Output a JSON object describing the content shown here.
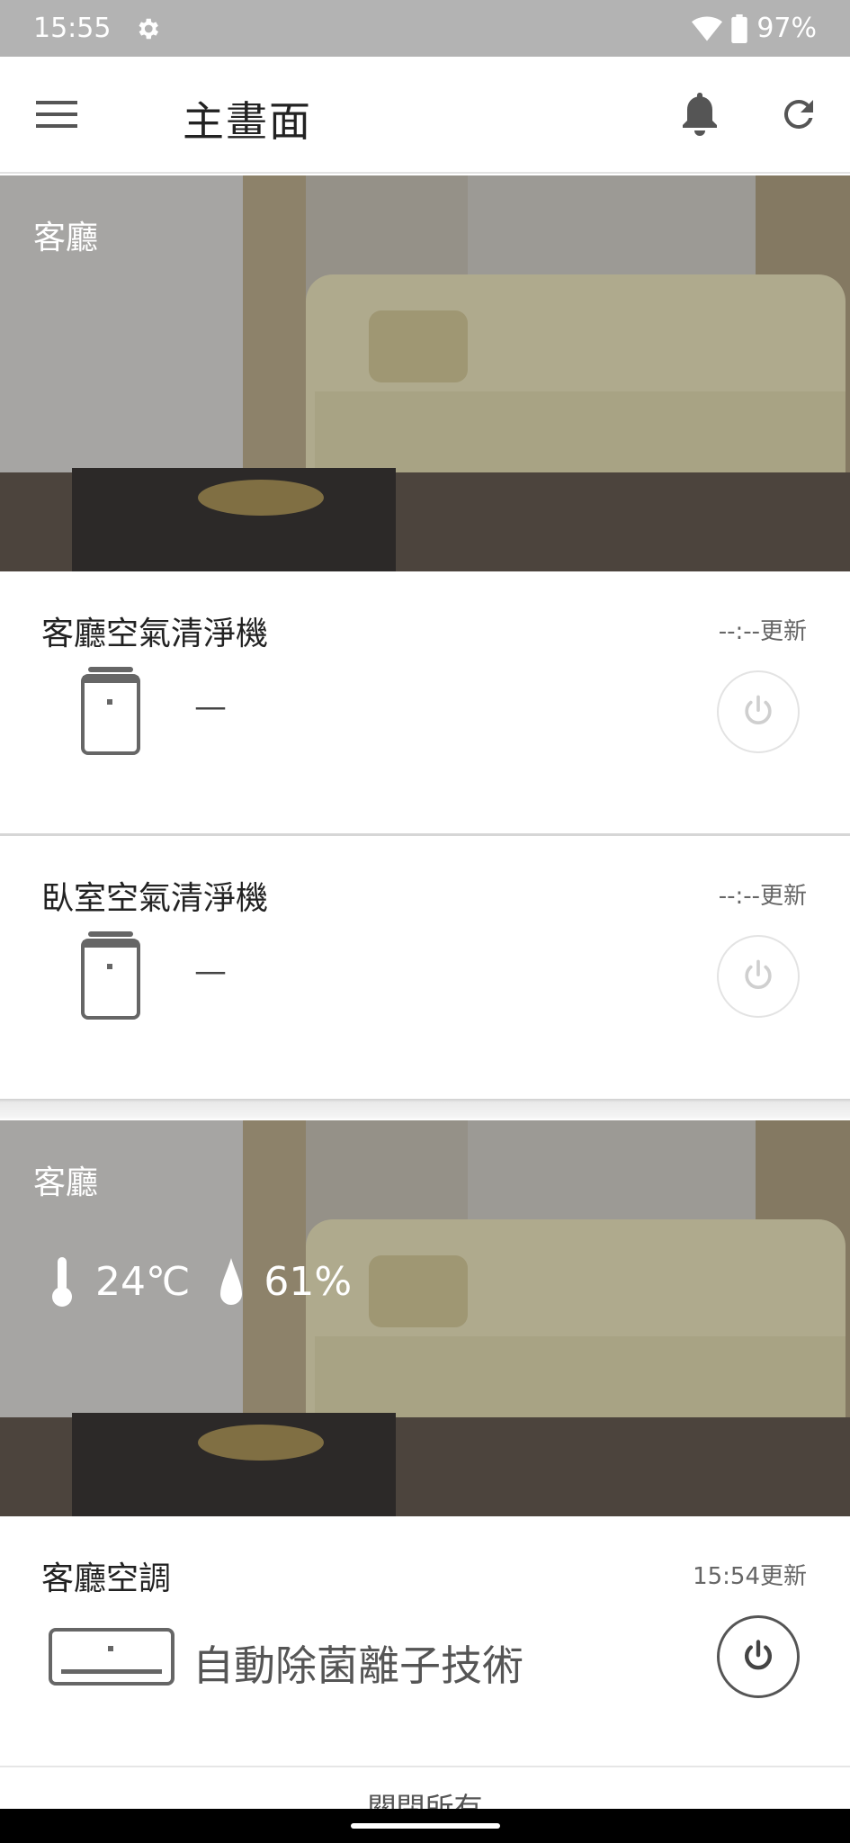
{
  "status_bar": {
    "time": "15:55",
    "battery": "97%"
  },
  "app_bar": {
    "title": "主畫面"
  },
  "rooms": [
    {
      "name": "客廳",
      "devices": [
        {
          "name": "客廳空氣清淨機",
          "updated": "--:--更新",
          "status": "—",
          "power": "off"
        },
        {
          "name": "臥室空氣清淨機",
          "updated": "--:--更新",
          "status": "—",
          "power": "off"
        }
      ]
    },
    {
      "name": "客廳",
      "temperature": "24℃",
      "humidity": "61%",
      "devices": [
        {
          "name": "客廳空調",
          "updated": "15:54更新",
          "status": "自動除菌離子技術",
          "power": "on"
        }
      ]
    }
  ],
  "footer": {
    "close_all_label": "關閉所有"
  },
  "colors": {
    "status_bar": "#b3b3b3",
    "text_primary": "#222222",
    "icon_gray": "#555555"
  }
}
